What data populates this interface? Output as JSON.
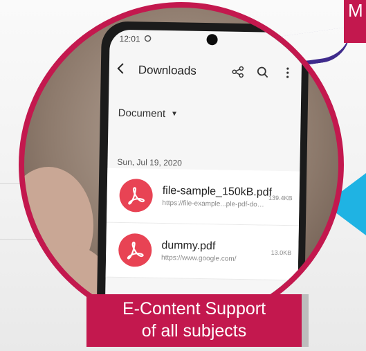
{
  "colors": {
    "accent": "#c3184e",
    "pdf_icon": "#e84354",
    "arrow": "#1fb3e3",
    "swoosh": "#3f2b8c"
  },
  "corner_banner": {
    "text": "M"
  },
  "phone": {
    "status_bar": {
      "time": "12:01"
    },
    "app_bar": {
      "title": "Downloads",
      "icons": [
        "back-arrow-icon",
        "share-icon",
        "search-icon",
        "more-vert-icon"
      ]
    },
    "filter": {
      "label": "Document"
    },
    "date_header": "Sun, Jul 19, 2020",
    "files": [
      {
        "name": "file-sample_150kB.pdf",
        "url": "https://file-example...ple-pdf-download/",
        "size": "139.4KB",
        "icon": "pdf-icon"
      },
      {
        "name": "dummy.pdf",
        "url": "https://www.google.com/",
        "size": "13.0KB",
        "icon": "pdf-icon"
      }
    ]
  },
  "caption": {
    "line1": "E-Content Support",
    "line2": "of all subjects"
  }
}
